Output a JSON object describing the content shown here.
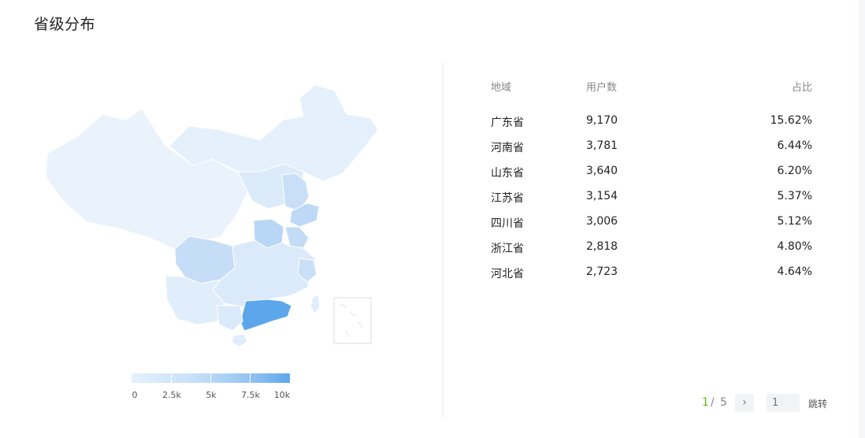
{
  "card": {
    "title": "省级分布"
  },
  "table": {
    "headers": {
      "region": "地域",
      "users": "用户数",
      "share": "占比"
    },
    "rows": [
      {
        "region": "广东省",
        "users": "9,170",
        "share": "15.62%"
      },
      {
        "region": "河南省",
        "users": "3,781",
        "share": "6.44%"
      },
      {
        "region": "山东省",
        "users": "3,640",
        "share": "6.20%"
      },
      {
        "region": "江苏省",
        "users": "3,154",
        "share": "5.37%"
      },
      {
        "region": "四川省",
        "users": "3,006",
        "share": "5.12%"
      },
      {
        "region": "浙江省",
        "users": "2,818",
        "share": "4.80%"
      },
      {
        "region": "河北省",
        "users": "2,723",
        "share": "4.64%"
      }
    ]
  },
  "pagination": {
    "current": "1",
    "separator": "/",
    "total": "5",
    "next_icon": "chevron-right-icon",
    "jump_placeholder": "1",
    "jump_label": "跳转"
  },
  "colors": {
    "low": "#e6f1fc",
    "high": "#5ca7ec",
    "highlight_province": "#5ca7ec"
  },
  "chart_data": {
    "type": "map",
    "title": "",
    "scale": {
      "min": 0,
      "max": 10000,
      "ticks": [
        "0",
        "2.5k",
        "5k",
        "7.5k",
        "10k"
      ]
    },
    "regions": [
      {
        "name": "广东省",
        "value": 9170
      },
      {
        "name": "河南省",
        "value": 3781
      },
      {
        "name": "山东省",
        "value": 3640
      },
      {
        "name": "江苏省",
        "value": 3154
      },
      {
        "name": "四川省",
        "value": 3006
      },
      {
        "name": "浙江省",
        "value": 2818
      },
      {
        "name": "河北省",
        "value": 2723
      }
    ]
  }
}
